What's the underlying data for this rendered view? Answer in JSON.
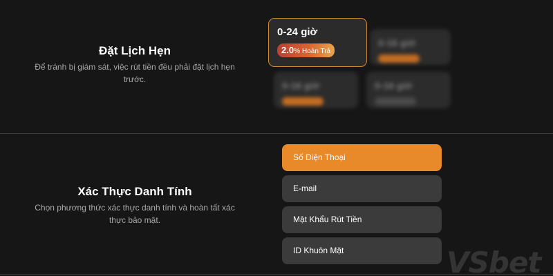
{
  "schedule": {
    "title": "Đặt Lịch Hẹn",
    "description": "Để tránh bị giám sát, việc rút tiền đều phải đặt lịch hẹn trước.",
    "active_card": {
      "title": "0-24 giờ",
      "badge_value": "2.0",
      "badge_unit": "%",
      "badge_label": "Hoàn Trả"
    },
    "blurred_cards": [
      {
        "title": "0-16 giờ"
      },
      {
        "title": "0-16 giờ"
      },
      {
        "title": "0-16 giờ"
      }
    ]
  },
  "verification": {
    "title": "Xác Thực Danh Tính",
    "description": "Chọn phương thức xác thực danh tính và hoàn tất xác thực bảo mật.",
    "options": [
      {
        "label": "Số Điện Thoại",
        "selected": true
      },
      {
        "label": "E-mail",
        "selected": false
      },
      {
        "label": "Mật Khẩu Rút Tiền",
        "selected": false
      },
      {
        "label": "ID Khuôn Mặt",
        "selected": false
      }
    ]
  },
  "watermark": "VSbet",
  "colors": {
    "background": "#161616",
    "accent": "#e8892a",
    "card": "#2c2c2c",
    "option": "#3b3b3b"
  }
}
